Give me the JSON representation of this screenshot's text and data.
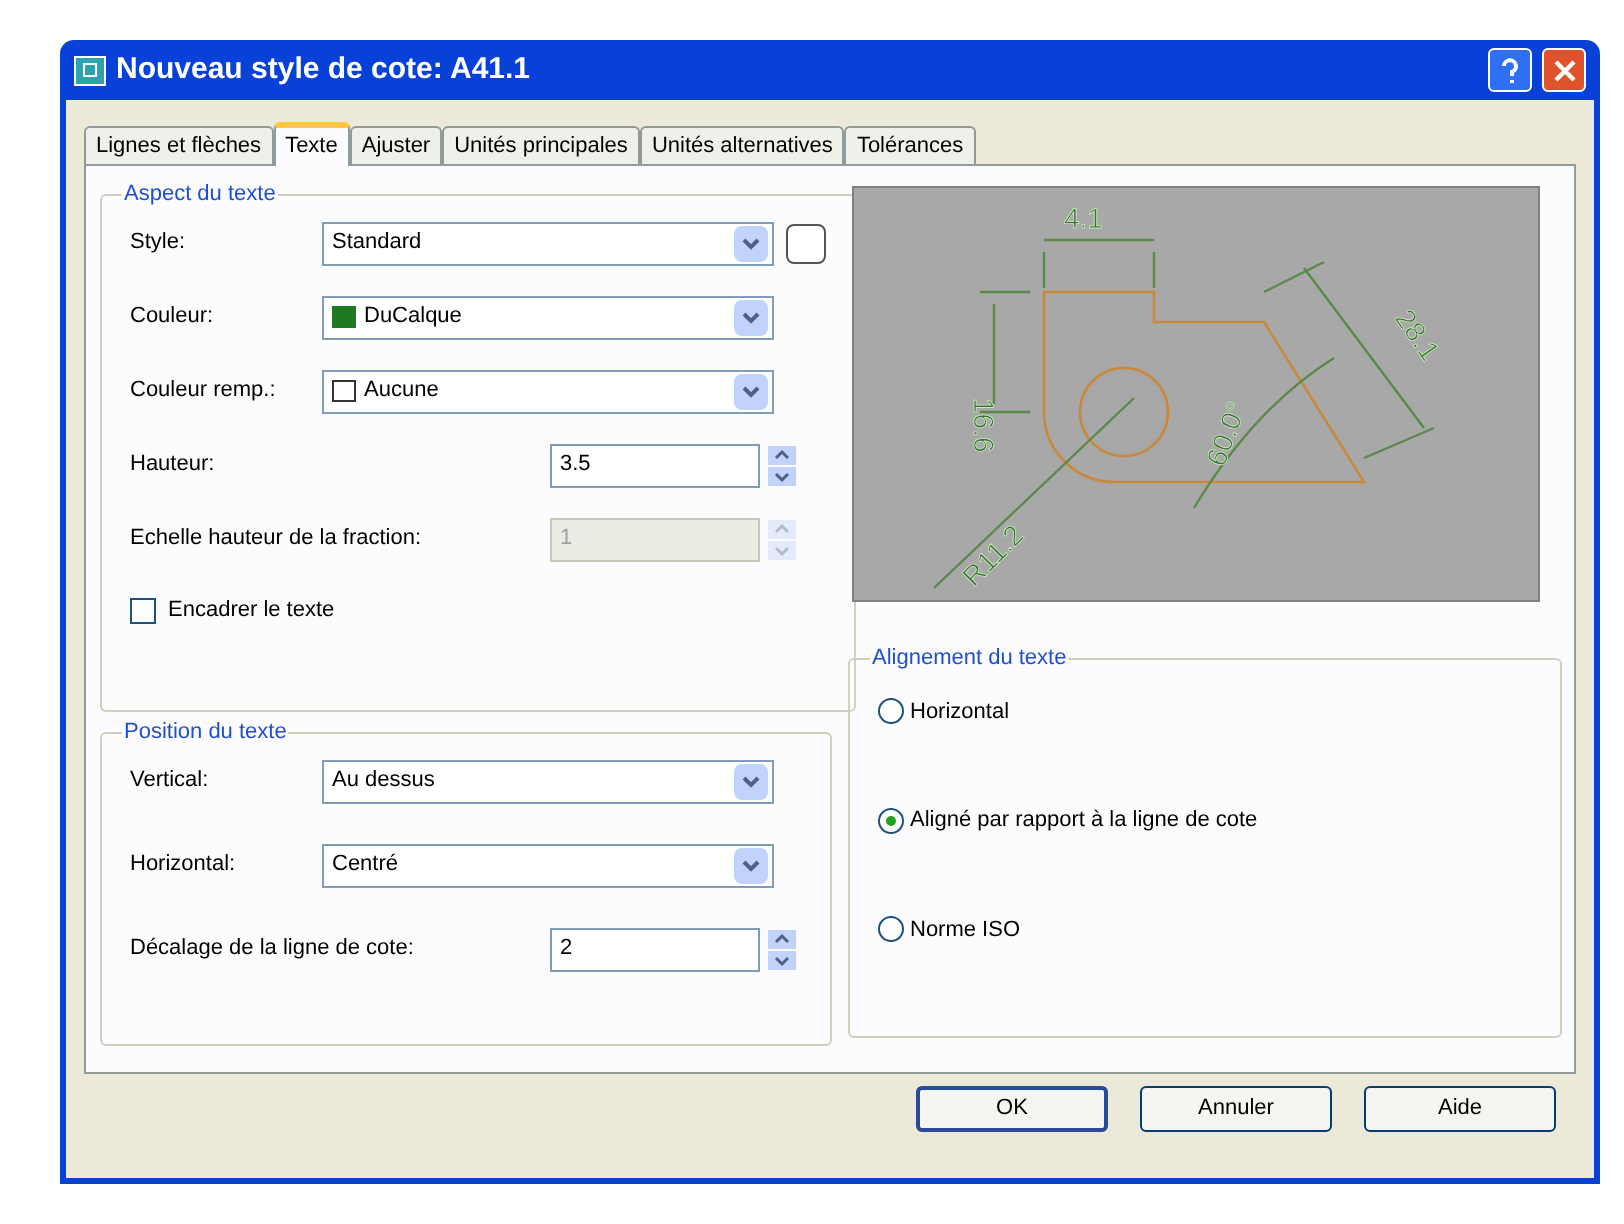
{
  "window": {
    "title": "Nouveau style de cote: A41.1"
  },
  "tabs": [
    {
      "label": "Lignes et flèches",
      "selected": false
    },
    {
      "label": "Texte",
      "selected": true
    },
    {
      "label": "Ajuster",
      "selected": false
    },
    {
      "label": "Unités principales",
      "selected": false
    },
    {
      "label": "Unités alternatives",
      "selected": false
    },
    {
      "label": "Tolérances",
      "selected": false
    }
  ],
  "aspect": {
    "title": "Aspect du texte",
    "fields": [
      {
        "kind": "combo",
        "label": "Style:",
        "value": "Standard",
        "extra_button": true
      },
      {
        "kind": "combo",
        "label": "Couleur:",
        "value": "DuCalque",
        "swatch": {
          "kind": "filled",
          "color": "#1e7a1e"
        }
      },
      {
        "kind": "combo",
        "label": "Couleur remp.:",
        "value": "Aucune",
        "swatch": {
          "kind": "empty"
        }
      },
      {
        "kind": "spin",
        "label": "Hauteur:",
        "value": "3.5",
        "disabled": false
      },
      {
        "kind": "spin",
        "label": "Echelle hauteur de la fraction:",
        "value": "1",
        "disabled": true
      },
      {
        "kind": "checkbox",
        "label": "Encadrer le texte",
        "checked": false
      }
    ]
  },
  "preview": {
    "labels": [
      "4.1",
      "16.6",
      "28.1",
      "60.0°",
      "R11.2"
    ]
  },
  "position": {
    "title": "Position du texte",
    "fields": [
      {
        "kind": "combo",
        "label": "Vertical:",
        "value": "Au dessus"
      },
      {
        "kind": "combo",
        "label": "Horizontal:",
        "value": "Centré"
      },
      {
        "kind": "spin",
        "label": "Décalage de la ligne de cote:",
        "value": "2",
        "disabled": false
      }
    ]
  },
  "alignment": {
    "title": "Alignement du texte",
    "options": [
      {
        "label": "Horizontal",
        "selected": false
      },
      {
        "label": "Aligné par rapport à la ligne de cote",
        "selected": true
      },
      {
        "label": "Norme ISO",
        "selected": false
      }
    ]
  },
  "buttons": [
    {
      "label": "OK",
      "default": true
    },
    {
      "label": "Annuler",
      "default": false
    },
    {
      "label": "Aide",
      "default": false
    }
  ]
}
